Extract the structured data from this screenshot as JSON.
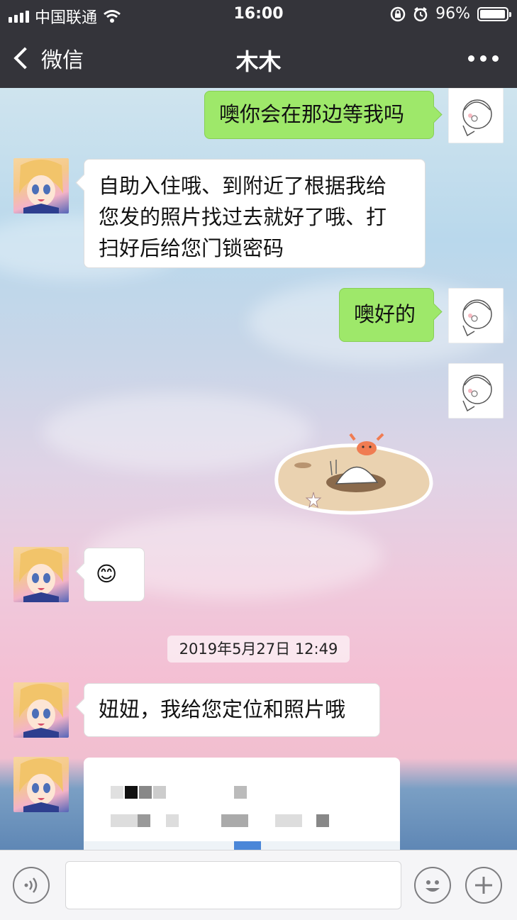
{
  "status_bar": {
    "carrier": "中国联通",
    "time": "16:00",
    "battery": "96%",
    "battery_level": 0.96,
    "icons": [
      "signal-icon",
      "wifi-icon",
      "rotation-lock-icon",
      "alarm-icon",
      "battery-icon"
    ]
  },
  "nav": {
    "back_label": "微信",
    "title": "木木",
    "more_icon": "more-dots-icon"
  },
  "messages": [
    {
      "from": "me",
      "type": "text",
      "text": "噢你会在那边等我吗"
    },
    {
      "from": "other",
      "type": "text",
      "lines": [
        "自助入住哦、到附近了根据我给",
        "您发的照片找过去就好了哦、打",
        "扫好后给您门锁密码"
      ]
    },
    {
      "from": "me",
      "type": "text",
      "text": "噢好的"
    },
    {
      "from": "me",
      "type": "sticker",
      "sticker": "crab-in-sand-sticker"
    },
    {
      "from": "other",
      "type": "emoji",
      "text": "😊"
    },
    {
      "type": "timestamp",
      "text": "2019年5月27日 12:49"
    },
    {
      "from": "other",
      "type": "text",
      "text": "妞妞，我给您定位和照片哦"
    },
    {
      "from": "other",
      "type": "location",
      "text": ""
    }
  ],
  "input_bar": {
    "voice_icon": "voice-icon",
    "emoji_icon": "emoji-icon",
    "plus_icon": "plus-icon",
    "input_value": ""
  }
}
